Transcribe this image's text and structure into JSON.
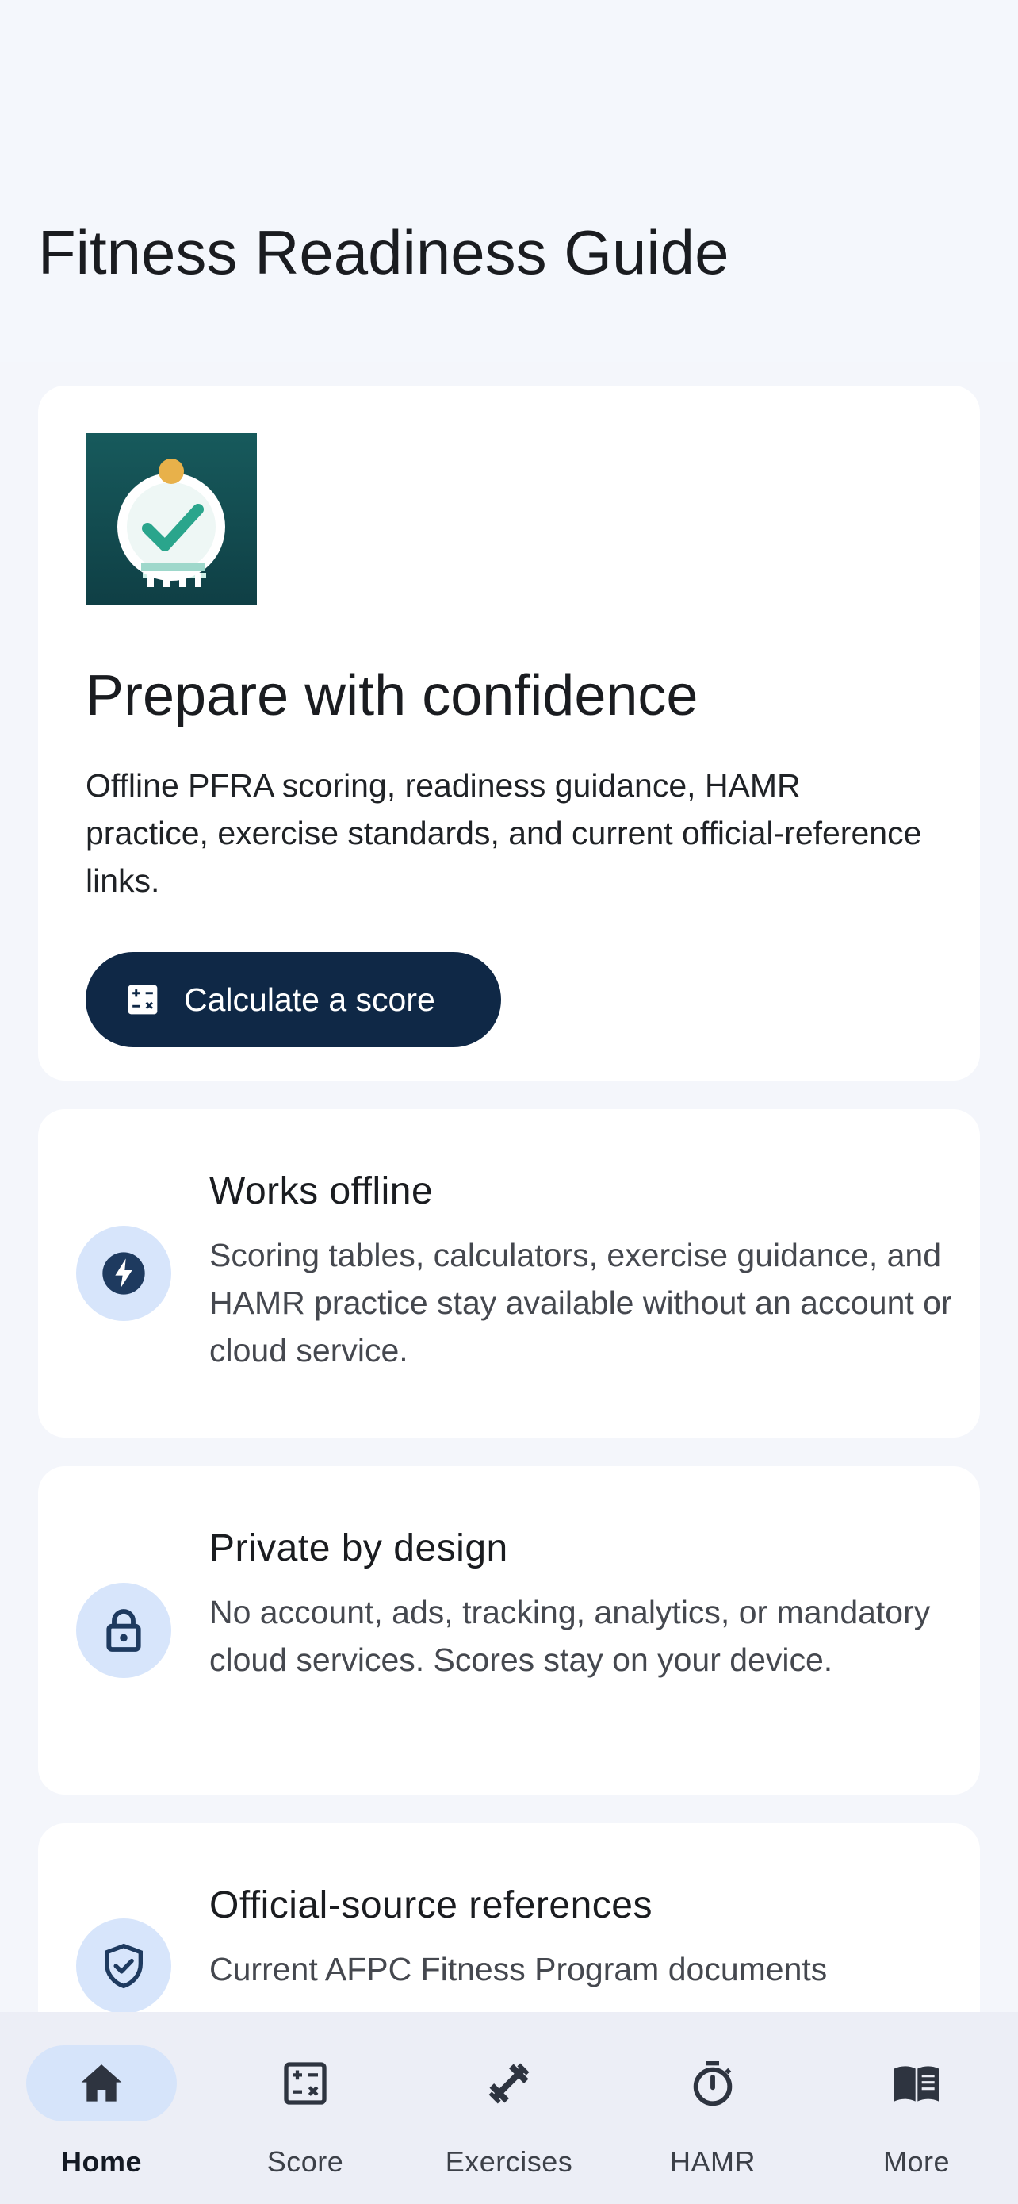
{
  "header": {
    "title": "Fitness Readiness Guide"
  },
  "hero": {
    "art_icon": "checkmark-medal-icon",
    "heading": "Prepare with confidence",
    "body": "Offline PFRA scoring, readiness guidance, HAMR practice, exercise standards, and current official-reference links.",
    "cta_label": "Calculate a score",
    "cta_icon": "calculator-icon"
  },
  "features": [
    {
      "icon": "lightning-bolt-icon",
      "title": "Works offline",
      "body": "Scoring tables, calculators, exercise guidance, and HAMR practice stay available without an account or cloud service."
    },
    {
      "icon": "lock-icon",
      "title": "Private by design",
      "body": "No account, ads, tracking, analytics, or mandatory cloud services. Scores stay on your device."
    },
    {
      "icon": "shield-check-icon",
      "title": "Official-source references",
      "body": "Current AFPC Fitness Program documents"
    }
  ],
  "nav": {
    "active": "Home",
    "items": [
      {
        "label": "Home",
        "icon": "home-icon"
      },
      {
        "label": "Score",
        "icon": "calculator-icon"
      },
      {
        "label": "Exercises",
        "icon": "dumbbell-icon"
      },
      {
        "label": "HAMR",
        "icon": "stopwatch-icon"
      },
      {
        "label": "More",
        "icon": "book-icon"
      }
    ]
  },
  "colors": {
    "primary": "#0F2846",
    "icon_bg": "#D7E5FB",
    "icon_fg": "#1E3A5F",
    "nav_bg": "#ECEEF6",
    "nav_active_pill": "#D6E4FA",
    "teal": "#2AA58C",
    "gold": "#E8B14A"
  }
}
